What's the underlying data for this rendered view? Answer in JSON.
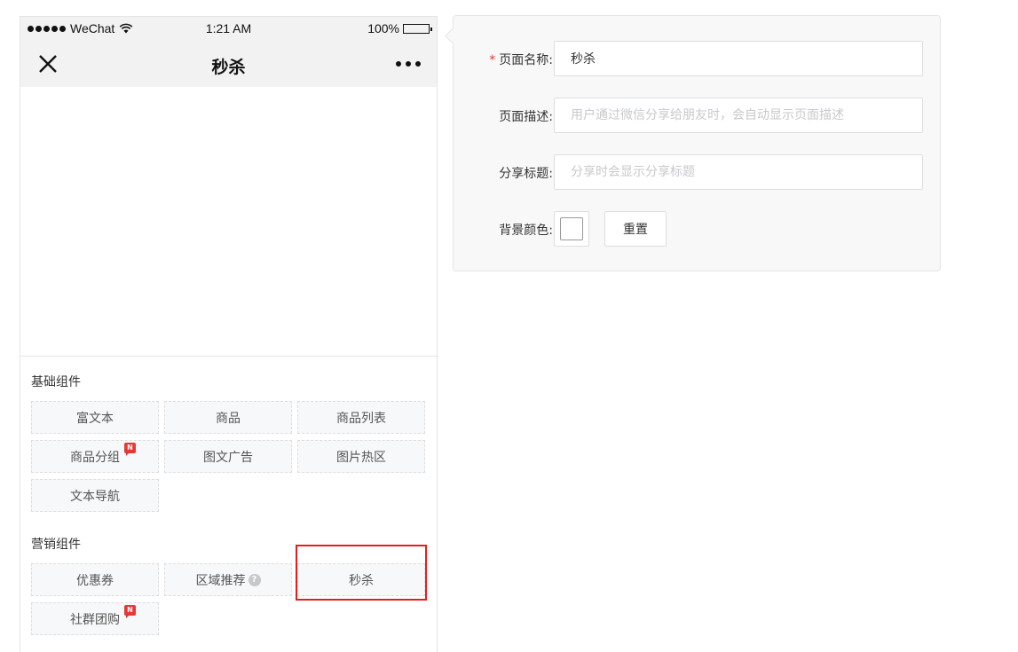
{
  "status_bar": {
    "carrier": "WeChat",
    "time": "1:21 AM",
    "battery": "100%",
    "battery_level": 1.0
  },
  "nav_bar": {
    "title": "秒杀"
  },
  "component_groups": [
    {
      "title": "基础组件",
      "items": [
        {
          "label": "富文本"
        },
        {
          "label": "商品"
        },
        {
          "label": "商品列表"
        },
        {
          "label": "商品分组",
          "badge": "N"
        },
        {
          "label": "图文广告"
        },
        {
          "label": "图片热区"
        },
        {
          "label": "文本导航"
        }
      ]
    },
    {
      "title": "营销组件",
      "items": [
        {
          "label": "优惠券"
        },
        {
          "label": "区域推荐",
          "help": "?"
        },
        {
          "label": "秒杀"
        },
        {
          "label": "社群团购",
          "badge": "N"
        }
      ]
    }
  ],
  "settings": {
    "page_name": {
      "required_mark": "*",
      "label": "页面名称:",
      "value": "秒杀"
    },
    "page_desc": {
      "label": "页面描述:",
      "placeholder": "用户通过微信分享给朋友时，会自动显示页面描述"
    },
    "share_title": {
      "label": "分享标题:",
      "placeholder": "分享时会显示分享标题"
    },
    "bg_color": {
      "label": "背景颜色:",
      "value": "#ffffff",
      "reset_label": "重置"
    }
  },
  "colors": {
    "required": "#e53935",
    "highlight": "#e02020",
    "badge": "#e53935"
  }
}
